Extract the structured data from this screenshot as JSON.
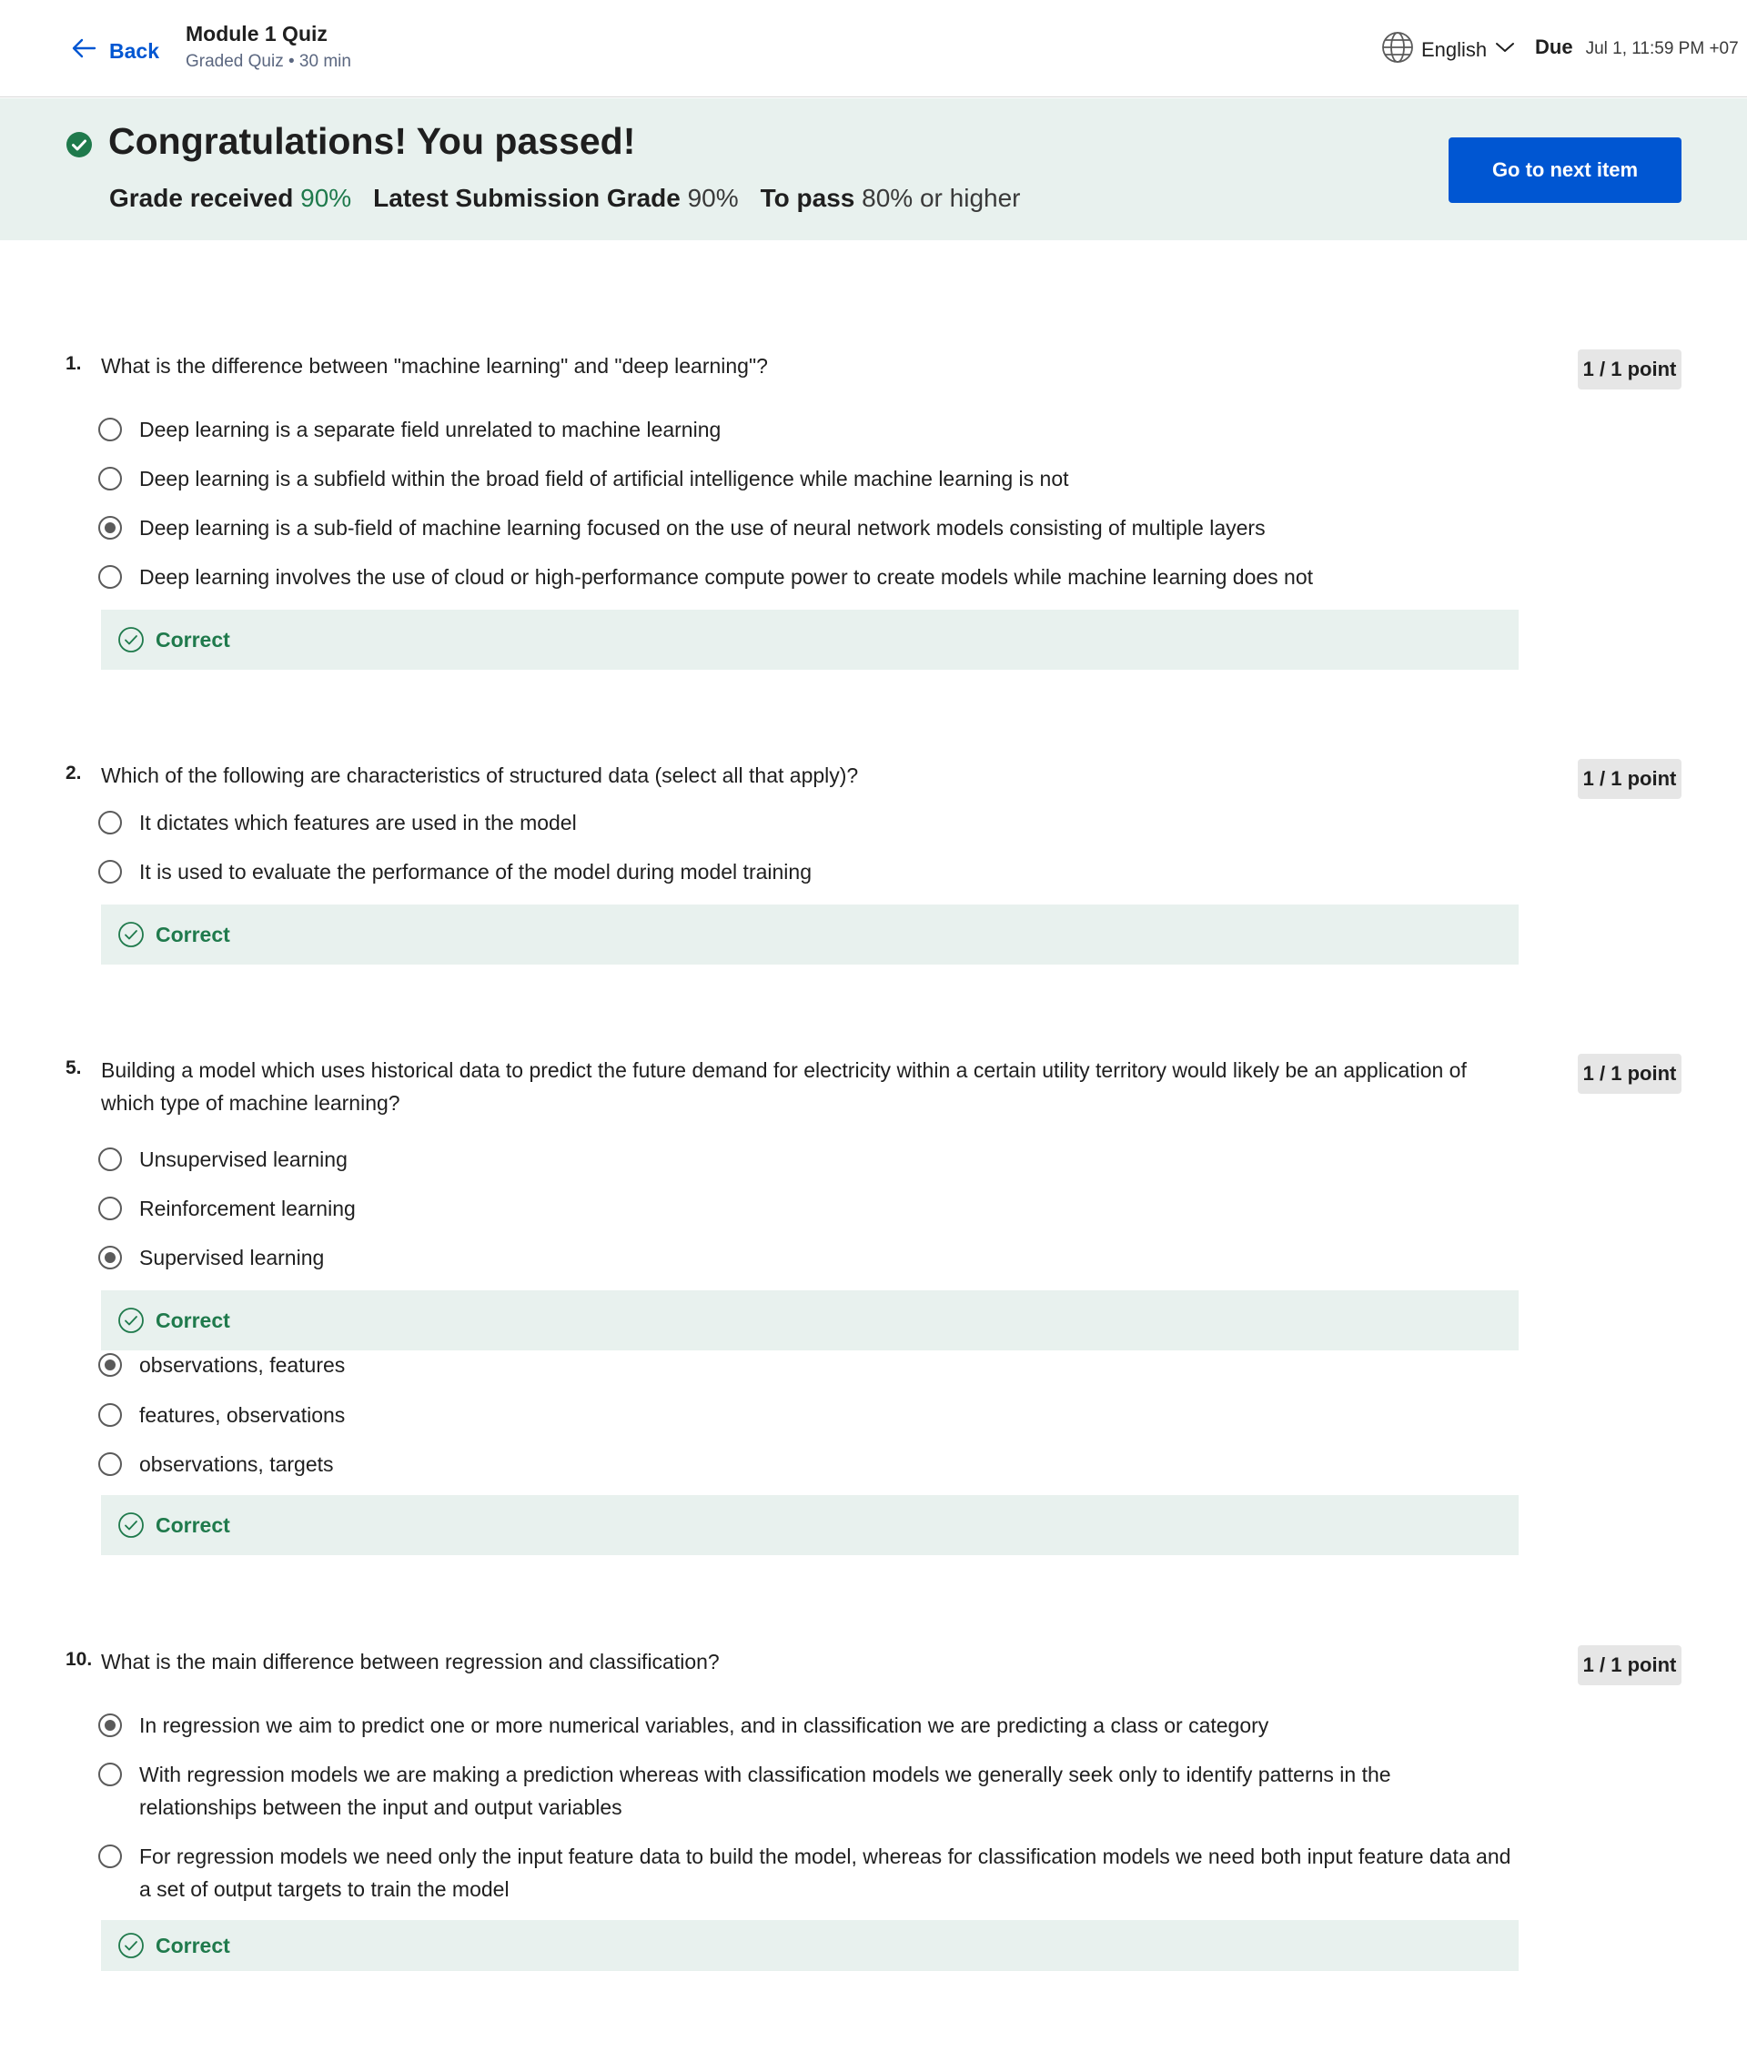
{
  "header": {
    "back_label": "Back",
    "title": "Module 1 Quiz",
    "subtitle": "Graded Quiz • 30 min",
    "language": "English",
    "due_label": "Due",
    "due_value": "Jul 1, 11:59 PM +07"
  },
  "banner": {
    "title": "Congratulations! You passed!",
    "grade_received_label": "Grade received",
    "grade_received_value": "90%",
    "latest_label": "Latest Submission Grade",
    "latest_value": "90%",
    "to_pass_label": "To pass",
    "to_pass_value": "80% or higher",
    "next_button": "Go to next item"
  },
  "colors": {
    "accent": "#0056d2",
    "success": "#1f7a4c",
    "success_bg": "#e8f1ee"
  },
  "questions": [
    {
      "number": "1.",
      "text": "What is the difference between \"machine learning\" and \"deep learning\"?",
      "points": "1 / 1 point",
      "options": [
        {
          "label": "Deep learning is a separate field unrelated to machine learning",
          "selected": false
        },
        {
          "label": "Deep learning is a subfield within the broad field of artificial intelligence while machine learning is not",
          "selected": false
        },
        {
          "label": "Deep learning is a sub-field of machine learning focused on the use of neural network models consisting of multiple layers",
          "selected": true
        },
        {
          "label": "Deep learning involves the use of cloud or high-performance compute power to create models while machine learning does not",
          "selected": false
        }
      ],
      "feedback": "Correct"
    },
    {
      "number": "2.",
      "text": "Which of the following are characteristics of structured data (select all that apply)?",
      "points": "1 / 1 point",
      "options": [
        {
          "label": "It dictates which features are used in the model",
          "selected": false
        },
        {
          "label": "It is used to evaluate the performance of the model during model training",
          "selected": false
        }
      ],
      "feedback": "Correct"
    },
    {
      "number": "5.",
      "text": "Building a model which uses historical data to predict the future demand for electricity within a certain utility territory would likely be an application of which type of machine learning?",
      "points": "1 / 1 point",
      "options": [
        {
          "label": "Unsupervised learning",
          "selected": false
        },
        {
          "label": "Reinforcement learning",
          "selected": false
        },
        {
          "label": "Supervised learning",
          "selected": true
        }
      ],
      "feedback": "Correct"
    },
    {
      "number": "",
      "text": "",
      "points": "",
      "options": [
        {
          "label": "observations, features",
          "selected": true
        },
        {
          "label": "features, observations",
          "selected": false
        },
        {
          "label": "observations, targets",
          "selected": false
        }
      ],
      "feedback": "Correct"
    },
    {
      "number": "10.",
      "text": "What is the main difference between regression and classification?",
      "points": "1 / 1 point",
      "options": [
        {
          "label": "In regression we aim to predict one or more numerical variables, and in classification we are predicting a class or category",
          "selected": true
        },
        {
          "label": "With regression models we are making a prediction whereas with classification models we generally seek only to identify patterns in the relationships between the input and output variables",
          "selected": false
        },
        {
          "label": "For regression models we need only the input feature data to build the model, whereas for classification models we need both input feature data and a set of output targets to train the model",
          "selected": false
        }
      ],
      "feedback": "Correct"
    }
  ]
}
